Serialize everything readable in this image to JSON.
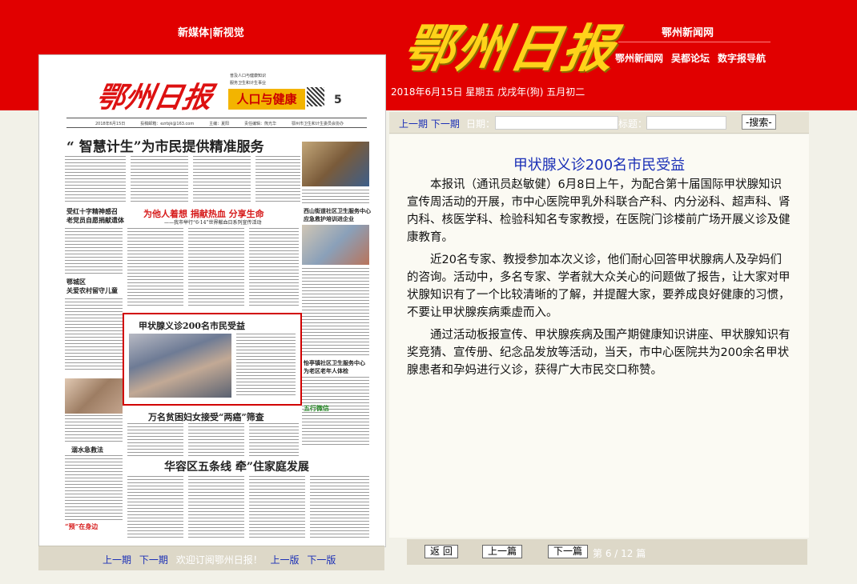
{
  "header": {
    "left_links": "新媒体|新视觉",
    "logo": "鄂州日报",
    "right_title": "鄂州新闻网",
    "right_links": [
      "鄂州新闻网",
      "吴都论坛",
      "数字报导航"
    ],
    "date": "2018年6月15日 星期五 戊戌年(狗) 五月初二"
  },
  "paper": {
    "logo": "鄂州日报",
    "section_tag": "人口与健康",
    "page_number": "5",
    "header_lines": [
      "普及人口与健康知识",
      "服务卫生和计生事业"
    ],
    "info_line": [
      "2018年6月15日",
      "投稿邮箱：ezrbjk@163.com",
      "主编：夏阳",
      "责任编辑：熊光华",
      "鄂州市卫生和计生委员会协办"
    ],
    "headline_main": "“ 智慧计生”为市民提供精准服务",
    "headline_left1": "受红十字精神感召\n老党员自愿捐献遗体",
    "headline_left2": "鄂城区\n关爱农村留守儿童",
    "headline_mid_red": "为他人着想  捐献热血  分享生命",
    "headline_mid_sub": "——我市举行“6·14”世界献血日系列宣传活动",
    "headline_right1": "西山街道社区卫生服务中心\n应急救护培训进企业",
    "headline_right2": "怡亭镇社区卫生服务中心\n为老区老年人体检",
    "highlight_title": "甲状腺义诊200名市民受益",
    "headline_bottom1": "万名贫困妇女接受“两癌”筛查",
    "headline_bottom2": "华容区五条线  牵”住家庭发展",
    "left_bottom_title": "溺水急救法",
    "badge": "五行微信",
    "corner_tag": "“预”在身边"
  },
  "paper_footer": {
    "prev_period": "上一期",
    "next_period": "下一期",
    "welcome": "欢迎订阅鄂州日报！",
    "prev_page": "上一版",
    "next_page": "下一版"
  },
  "toolbar": {
    "prev_period": "上一期",
    "next_period": "下一期",
    "date_label": "日期：",
    "title_label": "标题：",
    "search_button": "-搜索-"
  },
  "article": {
    "title": "甲状腺义诊200名市民受益",
    "paragraphs": [
      "本报讯（通讯员赵敏健）6月8日上午，为配合第十届国际甲状腺知识宣传周活动的开展，市中心医院甲乳外科联合产科、内分泌科、超声科、肾内科、核医学科、检验科知名专家教授，在医院门诊楼前广场开展义诊及健康教育。",
      "近20名专家、教授参加本次义诊，他们耐心回答甲状腺病人及孕妈们的咨询。活动中，多名专家、学者就大众关心的问题做了报告，让大家对甲状腺知识有了一个比较清晰的了解，并提醒大家，要养成良好健康的习惯，不要让甲状腺疾病乘虚而入。",
      "通过活动板报宣传、甲状腺疾病及围产期健康知识讲座、甲状腺知识有奖竞猜、宣传册、纪念品发放等活动，当天，市中心医院共为200余名甲状腺患者和孕妈进行义诊，获得广大市民交口称赞。"
    ]
  },
  "bottom_nav": {
    "back": "返 回",
    "prev": "上一篇",
    "next": "下一篇",
    "count": "第 6 / 12 篇"
  },
  "colors": {
    "header_red": "#e10000",
    "logo_gold": "#ffd21a",
    "link_blue": "#1a2fb6",
    "highlight_red": "#d10000"
  }
}
